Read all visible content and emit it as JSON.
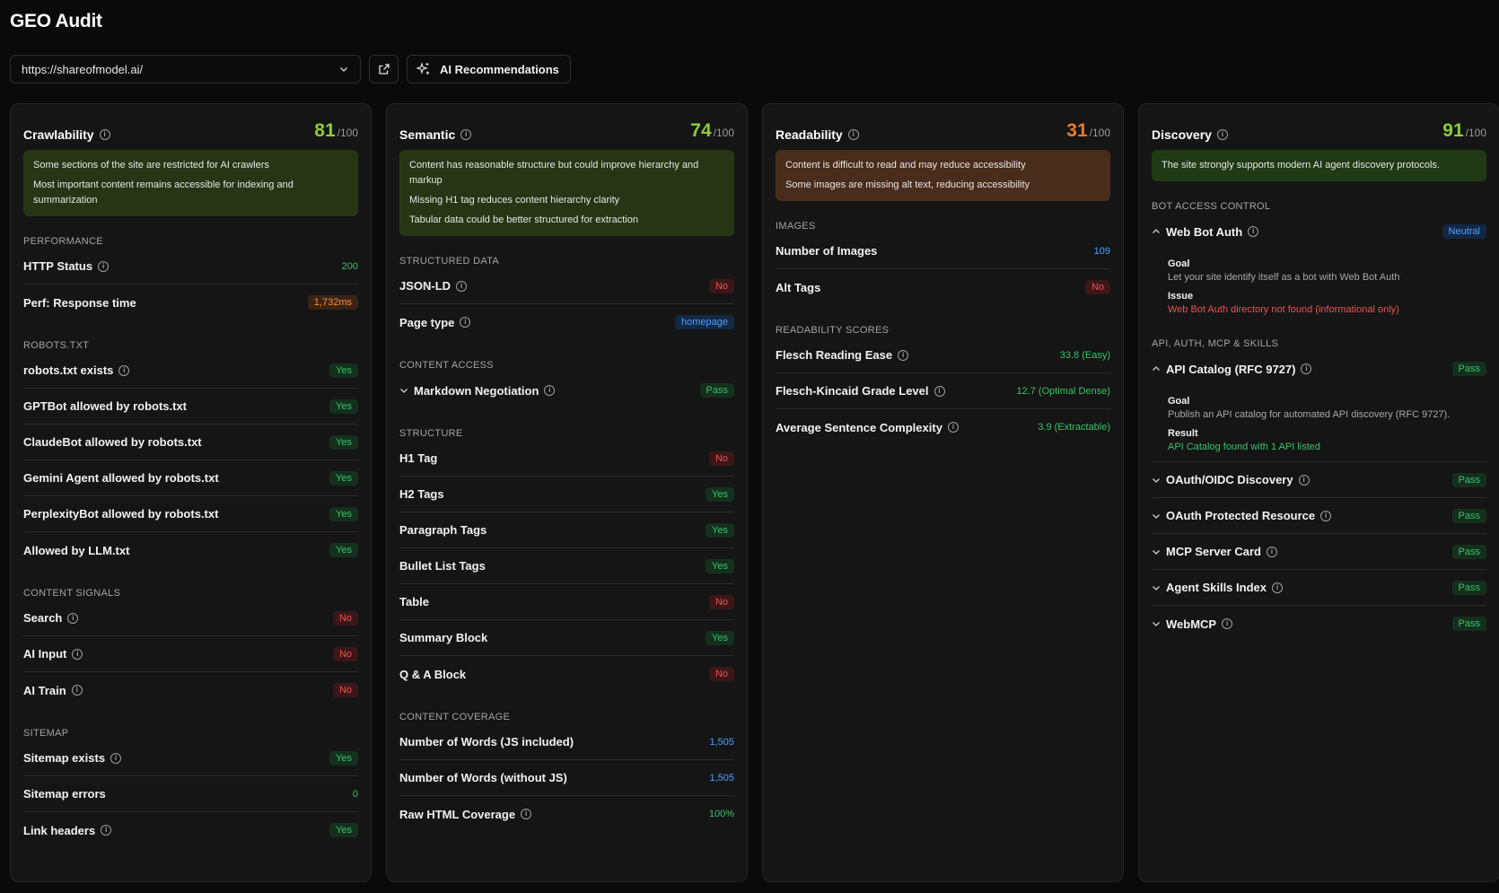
{
  "app": {
    "title": "GEO Audit"
  },
  "toolbar": {
    "url": "https://shareofmodel.ai/",
    "ai_label": "AI Recommendations"
  },
  "cards": {
    "crawl": {
      "title": "Crawlability",
      "score": "81",
      "denom": "/100",
      "summary": [
        "Some sections of the site are restricted for AI crawlers",
        "Most important content remains accessible for indexing and summarization"
      ],
      "sections": {
        "performance": "PERFORMANCE",
        "robots": "ROBOTS.TXT",
        "signals": "CONTENT SIGNALS",
        "sitemap": "SITEMAP"
      },
      "rows": {
        "http": {
          "label": "HTTP Status",
          "value": "200"
        },
        "perf": {
          "label": "Perf: Response time",
          "value": "1,732ms"
        },
        "robots_exists": {
          "label": "robots.txt exists",
          "value": "Yes"
        },
        "gptbot": {
          "label": "GPTBot allowed by robots.txt",
          "value": "Yes"
        },
        "claudebot": {
          "label": "ClaudeBot allowed by robots.txt",
          "value": "Yes"
        },
        "gemini": {
          "label": "Gemini Agent allowed by robots.txt",
          "value": "Yes"
        },
        "perplexity": {
          "label": "PerplexityBot allowed by robots.txt",
          "value": "Yes"
        },
        "llm": {
          "label": "Allowed by LLM.txt",
          "value": "Yes"
        },
        "search": {
          "label": "Search",
          "value": "No"
        },
        "ai_input": {
          "label": "AI Input",
          "value": "No"
        },
        "ai_train": {
          "label": "AI Train",
          "value": "No"
        },
        "sitemap_exists": {
          "label": "Sitemap exists",
          "value": "Yes"
        },
        "sitemap_errors": {
          "label": "Sitemap errors",
          "value": "0"
        },
        "link_headers": {
          "label": "Link headers",
          "value": "Yes"
        }
      }
    },
    "semantic": {
      "title": "Semantic",
      "score": "74",
      "denom": "/100",
      "summary": [
        "Content has reasonable structure but could improve hierarchy and markup",
        "Missing H1 tag reduces content hierarchy clarity",
        "Tabular data could be better structured for extraction"
      ],
      "sections": {
        "structured": "STRUCTURED DATA",
        "access": "CONTENT ACCESS",
        "structure": "STRUCTURE",
        "coverage": "CONTENT COVERAGE"
      },
      "rows": {
        "jsonld": {
          "label": "JSON-LD",
          "value": "No"
        },
        "pagetype": {
          "label": "Page type",
          "value": "homepage"
        },
        "markdown": {
          "label": "Markdown Negotiation",
          "value": "Pass"
        },
        "h1": {
          "label": "H1 Tag",
          "value": "No"
        },
        "h2": {
          "label": "H2 Tags",
          "value": "Yes"
        },
        "para": {
          "label": "Paragraph Tags",
          "value": "Yes"
        },
        "bullet": {
          "label": "Bullet List Tags",
          "value": "Yes"
        },
        "table": {
          "label": "Table",
          "value": "No"
        },
        "summary": {
          "label": "Summary Block",
          "value": "Yes"
        },
        "qa": {
          "label": "Q & A Block",
          "value": "No"
        },
        "words_js": {
          "label": "Number of Words (JS included)",
          "value": "1,505"
        },
        "words_nojs": {
          "label": "Number of Words (without JS)",
          "value": "1,505"
        },
        "raw_html": {
          "label": "Raw HTML Coverage",
          "value": "100%"
        }
      }
    },
    "read": {
      "title": "Readability",
      "score": "31",
      "denom": "/100",
      "summary": [
        "Content is difficult to read and may reduce accessibility",
        "Some images are missing alt text, reducing accessibility"
      ],
      "sections": {
        "images": "IMAGES",
        "scores": "READABILITY SCORES"
      },
      "rows": {
        "num_images": {
          "label": "Number of Images",
          "value": "109"
        },
        "alt": {
          "label": "Alt Tags",
          "value": "No"
        },
        "flesch": {
          "label": "Flesch Reading Ease",
          "value": "33.8 (Easy)"
        },
        "fk": {
          "label": "Flesch-Kincaid Grade Level",
          "value": "12.7 (Optimal Dense)"
        },
        "asc": {
          "label": "Average Sentence Complexity",
          "value": "3.9 (Extractable)"
        }
      }
    },
    "disc": {
      "title": "Discovery",
      "score": "91",
      "denom": "/100",
      "summary": [
        "The site strongly supports modern AI agent discovery protocols."
      ],
      "sections": {
        "bot": "BOT ACCESS CONTROL",
        "api": "API, AUTH, MCP & SKILLS"
      },
      "webbot": {
        "label": "Web Bot Auth",
        "value": "Neutral",
        "goal_key": "Goal",
        "goal": "Let your site identify itself as a bot with Web Bot Auth",
        "issue_key": "Issue",
        "issue": "Web Bot Auth directory not found (informational only)"
      },
      "api_catalog": {
        "label": "API Catalog (RFC 9727)",
        "value": "Pass",
        "goal_key": "Goal",
        "goal": "Publish an API catalog for automated API discovery (RFC 9727).",
        "result_key": "Result",
        "result": "API Catalog found with 1 API listed"
      },
      "rows": {
        "oauth_oidc": {
          "label": "OAuth/OIDC Discovery",
          "value": "Pass"
        },
        "oauth_pr": {
          "label": "OAuth Protected Resource",
          "value": "Pass"
        },
        "mcp": {
          "label": "MCP Server Card",
          "value": "Pass"
        },
        "skills": {
          "label": "Agent Skills Index",
          "value": "Pass"
        },
        "webmcp": {
          "label": "WebMCP",
          "value": "Pass"
        }
      }
    }
  }
}
